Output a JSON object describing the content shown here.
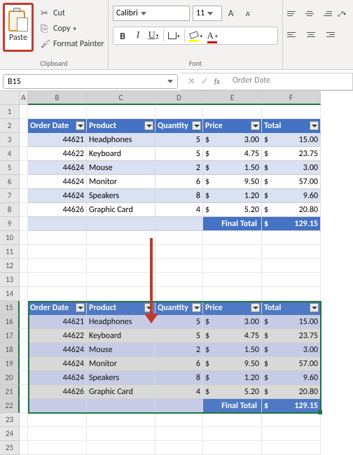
{
  "ribbon": {
    "clipboard": {
      "paste": "Paste",
      "cut": "Cut",
      "copy": "Copy",
      "painter": "Format Painter",
      "group": "Clipboard"
    },
    "font": {
      "name": "Calibri",
      "size": "11",
      "bold": "B",
      "italic": "I",
      "underline": "U",
      "fontcolor": "A",
      "group": "Font"
    }
  },
  "formula_bar": {
    "name_box": "B15",
    "content": "Order Date"
  },
  "columns": [
    "A",
    "B",
    "C",
    "D",
    "E",
    "F"
  ],
  "headers": {
    "order_date": "Order Date",
    "product": "Product",
    "quantity": "Quantity",
    "price": "Price",
    "total": "Total"
  },
  "rows": [
    {
      "n": 1
    },
    {
      "n": 2,
      "header": true
    },
    {
      "n": 3,
      "od": "44621",
      "prod": "Headphones",
      "qty": "5",
      "price": "3.00",
      "total": "15.00",
      "s": 1
    },
    {
      "n": 4,
      "od": "44622",
      "prod": "Keyboard",
      "qty": "5",
      "price": "4.75",
      "total": "23.75",
      "s": 2
    },
    {
      "n": 5,
      "od": "44624",
      "prod": "Mouse",
      "qty": "2",
      "price": "1.50",
      "total": "3.00",
      "s": 1
    },
    {
      "n": 6,
      "od": "44624",
      "prod": "Monitor",
      "qty": "6",
      "price": "9.50",
      "total": "57.00",
      "s": 2
    },
    {
      "n": 7,
      "od": "44624",
      "prod": "Speakers",
      "qty": "8",
      "price": "1.20",
      "total": "9.60",
      "s": 1
    },
    {
      "n": 8,
      "od": "44626",
      "prod": "Graphic Card",
      "qty": "4",
      "price": "5.20",
      "total": "20.80",
      "s": 2
    },
    {
      "n": 9,
      "footer": true
    }
  ],
  "footer": {
    "label": "Final Total",
    "total": "129.15"
  },
  "table2_start": 15,
  "empty_rows_before": [
    10,
    11,
    12,
    13,
    14
  ],
  "empty_rows_after": [
    23,
    24,
    25
  ]
}
